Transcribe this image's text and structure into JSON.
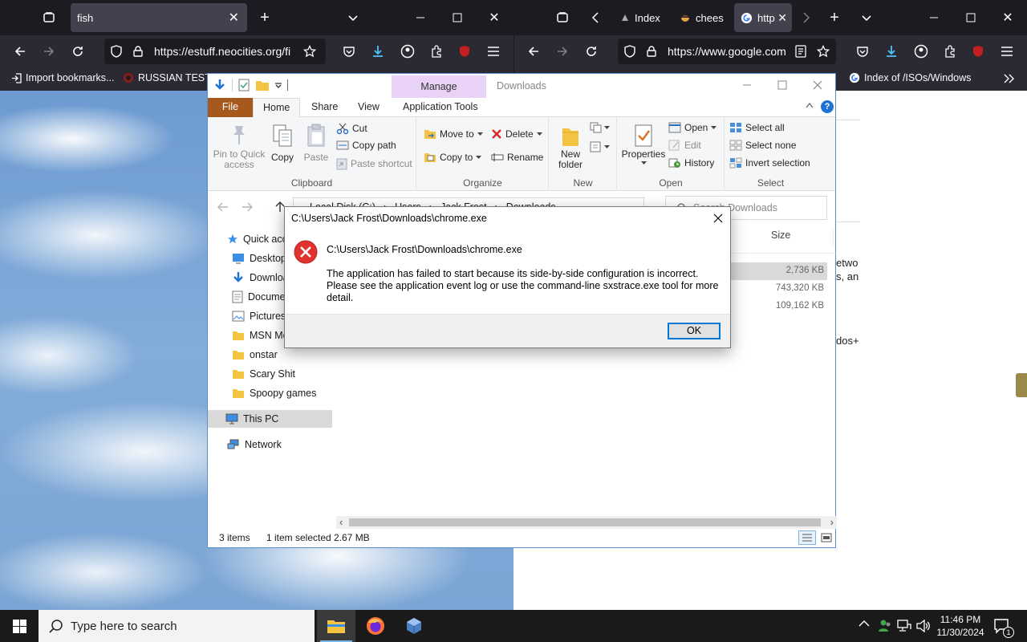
{
  "left_browser": {
    "tabs": [
      {
        "label": "fish",
        "active": true
      }
    ],
    "url": "https://estuff.neocities.org/fi",
    "bookmarks": [
      "Import bookmarks...",
      "RUSSIAN TEST"
    ]
  },
  "right_browser": {
    "tabs": [
      {
        "label": "Index",
        "active": false
      },
      {
        "label": "chees",
        "active": false
      },
      {
        "label": "http",
        "active": true
      }
    ],
    "url": "https://www.google.com",
    "bookmarks": [
      "Index of /ISOs/Windows"
    ],
    "page_fragments": [
      "etwo",
      "s, an",
      "dos+"
    ]
  },
  "explorer": {
    "title": "Downloads",
    "context_tab": "Manage",
    "ribbon_tabs": [
      "File",
      "Home",
      "Share",
      "View",
      "Application Tools"
    ],
    "clipboard": {
      "pin": "Pin to Quick access",
      "copy": "Copy",
      "paste": "Paste",
      "cut": "Cut",
      "copy_path": "Copy path",
      "paste_shortcut": "Paste shortcut",
      "label": "Clipboard"
    },
    "organize": {
      "move_to": "Move to",
      "copy_to": "Copy to",
      "delete": "Delete",
      "rename": "Rename",
      "label": "Organize"
    },
    "new_group": {
      "new_folder": "New folder",
      "label": "New"
    },
    "open_group": {
      "properties": "Properties",
      "open": "Open",
      "edit": "Edit",
      "history": "History",
      "label": "Open"
    },
    "select_group": {
      "select_all": "Select all",
      "select_none": "Select none",
      "invert": "Invert selection",
      "label": "Select"
    },
    "breadcrumb": [
      "Local Disk (C:)",
      "Users",
      "Jack Frost",
      "Downloads"
    ],
    "search_placeholder": "Search Downloads",
    "nav_items": [
      {
        "label": "Quick access",
        "icon": "star-icon"
      },
      {
        "label": "Desktop",
        "icon": "desktop-icon"
      },
      {
        "label": "Downloads",
        "icon": "download-icon"
      },
      {
        "label": "Documents",
        "icon": "document-icon"
      },
      {
        "label": "Pictures",
        "icon": "picture-icon"
      },
      {
        "label": "MSN Messenger",
        "icon": "folder-icon"
      },
      {
        "label": "onstar",
        "icon": "folder-icon"
      },
      {
        "label": "Scary Shit",
        "icon": "folder-icon"
      },
      {
        "label": "Spoopy games",
        "icon": "folder-icon"
      },
      {
        "label": "This PC",
        "icon": "pc-icon"
      },
      {
        "label": "Network",
        "icon": "network-icon"
      }
    ],
    "column_size": "Size",
    "file_sizes": [
      "2,736 KB",
      "743,320 KB",
      "109,162 KB"
    ],
    "status": {
      "items": "3 items",
      "selected": "1 item selected",
      "size": "2.67 MB"
    }
  },
  "dialog": {
    "title": "C:\\Users\\Jack Frost\\Downloads\\chrome.exe",
    "path": "C:\\Users\\Jack Frost\\Downloads\\chrome.exe",
    "message": "The application has failed to start because its side-by-side configuration is incorrect. Please see the application event log or use the command-line sxstrace.exe tool for more detail.",
    "ok": "OK"
  },
  "taskbar": {
    "search_placeholder": "Type here to search",
    "time": "11:46 PM",
    "date": "11/30/2024",
    "notification_count": "1"
  }
}
